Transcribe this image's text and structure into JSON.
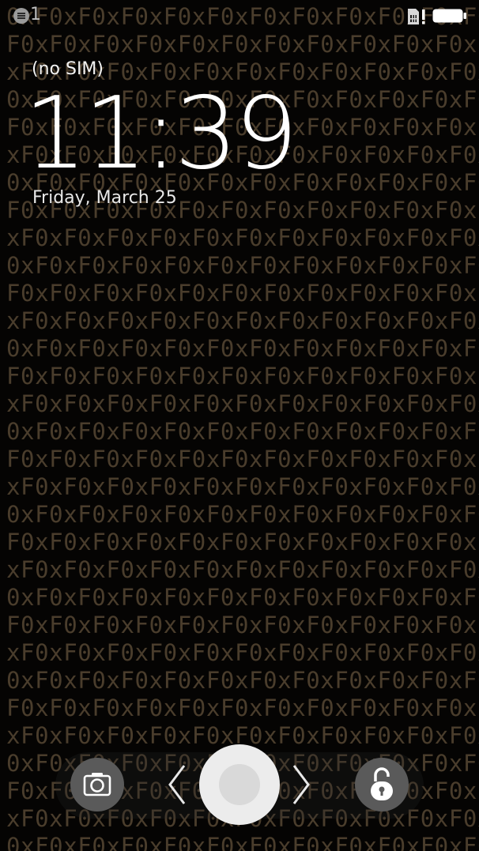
{
  "wallpaper": {
    "pattern_text": "0xF",
    "text_color": "#4a3d2c"
  },
  "status_bar": {
    "notification_icon": "notifications-icon",
    "notification_count": "1",
    "sim_icon": "sim-alert-icon",
    "battery_icon": "battery-full-icon"
  },
  "lockscreen": {
    "carrier": "(no SIM)",
    "time": "11:39",
    "date": "Friday, March 25"
  },
  "lockbar": {
    "camera_icon": "camera-icon",
    "left_chevron_icon": "chevron-left-icon",
    "handle_icon": "slider-handle-icon",
    "right_chevron_icon": "chevron-right-icon",
    "unlock_icon": "unlock-icon"
  }
}
